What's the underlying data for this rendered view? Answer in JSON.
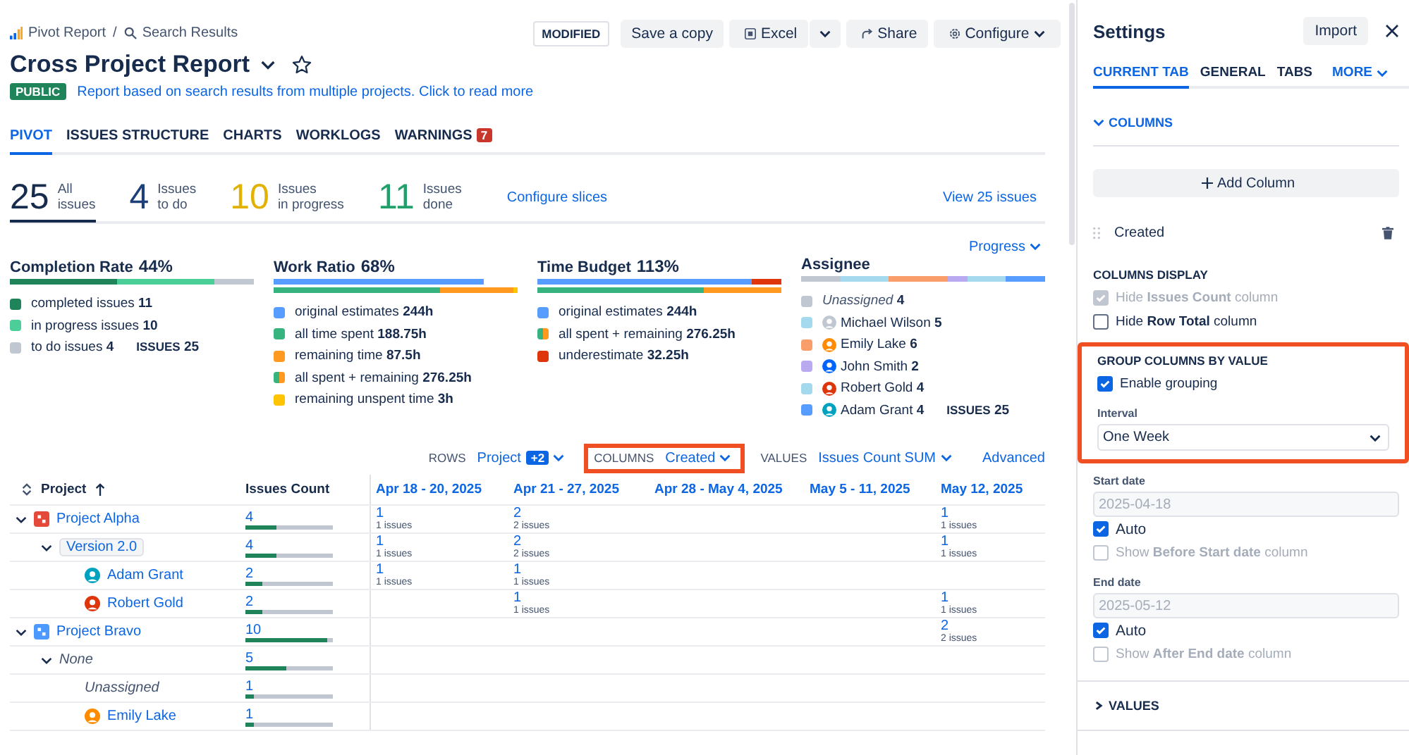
{
  "breadcrumb": {
    "items": [
      {
        "label": "Pivot Report"
      },
      {
        "label": "Search Results"
      }
    ],
    "separator": "/"
  },
  "header": {
    "title": "Cross Project Report",
    "badge": "PUBLIC",
    "description": "Report based on search results from multiple projects. Click to read more",
    "status": "MODIFIED",
    "buttons": [
      {
        "kind": "plain",
        "label": "Save a copy"
      },
      {
        "kind": "excel",
        "label": "Excel"
      },
      {
        "kind": "caret"
      },
      {
        "kind": "share",
        "label": "Share"
      },
      {
        "kind": "configure",
        "label": "Configure"
      }
    ]
  },
  "tabs": [
    {
      "label": "PIVOT",
      "selected": true
    },
    {
      "label": "ISSUES STRUCTURE",
      "selected": false
    },
    {
      "label": "CHARTS",
      "selected": false
    },
    {
      "label": "WORKLOGS",
      "selected": false
    },
    {
      "label": "WARNINGS",
      "selected": false,
      "count": "7"
    }
  ],
  "slices": [
    {
      "value": "25",
      "label": "All\nissues",
      "color": "#172b4d",
      "selected": true
    },
    {
      "value": "4",
      "label": "Issues\nto do",
      "color": "#1d3f7a",
      "selected": false
    },
    {
      "value": "10",
      "label": "Issues\nin progress",
      "color": "#e2b203",
      "selected": false
    },
    {
      "value": "11",
      "label": "Issues\ndone",
      "color": "#22a06b",
      "selected": false
    }
  ],
  "configure_slices": "Configure slices",
  "view_issues": "View 25 issues",
  "group_dropdown": "Progress",
  "metrics": [
    {
      "title": "Completion Rate",
      "value": "44%",
      "bars": [
        {
          "segments": [
            {
              "color": "#1f845a"
            },
            {
              "color": "#4bce97"
            },
            {
              "color": "#c1c7d0"
            }
          ]
        }
      ],
      "legend": [
        {
          "kind": "swatch",
          "label": "completed issues",
          "value": "11",
          "color": "#1f845a"
        },
        {
          "kind": "swatch",
          "label": "in progress issues",
          "value": "10",
          "color": "#4bce97"
        },
        {
          "kind": "swatch",
          "label": "to do issues",
          "value": "4",
          "color": "#c1c7d0"
        }
      ],
      "total_label": "ISSUES",
      "total": "25"
    },
    {
      "title": "Work Ratio",
      "value": "68%",
      "bars": [
        {
          "segments": [
            {
              "color": "#579dff"
            }
          ]
        },
        {
          "segments": [
            {
              "color": "#36b37e"
            },
            {
              "color": "#ff991f"
            },
            {
              "color": "#ffc400"
            }
          ]
        }
      ],
      "legend": [
        {
          "kind": "swatch",
          "label": "original estimates",
          "value": "244h",
          "color": "#579dff"
        },
        {
          "kind": "swatch",
          "label": "all time spent",
          "value": "188.75h",
          "color": "#36b37e"
        },
        {
          "kind": "swatch",
          "label": "remaining time",
          "value": "87.5h",
          "color": "#ff991f"
        },
        {
          "kind": "split",
          "label": "all spent + remaining",
          "value": "276.25h"
        },
        {
          "kind": "swatch",
          "label": "remaining unspent time",
          "value": "3h",
          "color": "#ffc400"
        }
      ]
    },
    {
      "title": "Time Budget",
      "value": "113%",
      "bars": [
        {
          "segments": [
            {
              "color": "#579dff"
            },
            {
              "color": "#de350b"
            }
          ]
        },
        {
          "segments": [
            {
              "color": "#36b37e"
            },
            {
              "color": "#ff991f"
            }
          ]
        }
      ],
      "legend": [
        {
          "kind": "swatch",
          "label": "original estimates",
          "value": "244h",
          "color": "#579dff"
        },
        {
          "kind": "split",
          "label": "all spent + remaining",
          "value": "276.25h"
        },
        {
          "kind": "swatch",
          "label": "underestimate",
          "value": "32.25h",
          "color": "#de350b"
        }
      ]
    },
    {
      "title": "Assignee",
      "bars": [
        {
          "segments": [
            {
              "color": "#c1c7d0"
            },
            {
              "color": "#a4d9ee"
            },
            {
              "color": "#f99d6b"
            },
            {
              "color": "#b8a9f0"
            },
            {
              "color": "#a4d9ee"
            },
            {
              "color": "#579dff"
            }
          ]
        }
      ],
      "legend": [
        {
          "kind": "unassigned",
          "label": "Unassigned",
          "value": "4",
          "color": "#c1c7d0"
        },
        {
          "kind": "person",
          "label": "Michael Wilson",
          "value": "5",
          "color": "#a4d9ee",
          "avatar": {
            "color": "#c1c7d0"
          }
        },
        {
          "kind": "person",
          "label": "Emily Lake",
          "value": "6",
          "color": "#f99d6b",
          "avatar": {
            "color": "#ff8b00"
          }
        },
        {
          "kind": "person",
          "label": "John Smith",
          "value": "2",
          "color": "#b8a9f0",
          "avatar": {
            "color": "#0065ff"
          }
        },
        {
          "kind": "person",
          "label": "Robert Gold",
          "value": "4",
          "color": "#a4d9ee",
          "avatar": {
            "color": "#de350b"
          }
        },
        {
          "kind": "person",
          "label": "Adam Grant",
          "value": "4",
          "color": "#579dff",
          "avatar": {
            "color": "#00a3bf"
          }
        }
      ],
      "total_label": "ISSUES",
      "total": "25"
    }
  ],
  "pivot_controls": [
    {
      "label": "ROWS",
      "value": "Project",
      "badge": "+2",
      "highlighted": false
    },
    {
      "label": "COLUMNS",
      "value": "Created",
      "highlighted": true
    },
    {
      "label": "VALUES",
      "value": "Issues Count SUM",
      "highlighted": false
    }
  ],
  "advanced": "Advanced",
  "table": {
    "columns": [
      "Project",
      "Issues Count"
    ],
    "date_columns": [
      "Apr 18 - 20, 2025",
      "Apr 21 - 27, 2025",
      "Apr 28 - May 4, 2025",
      "May 5 - 11, 2025",
      "May 12, 2025"
    ],
    "rows": [
      {
        "kind": "project",
        "label": "Project Alpha",
        "color": "#e5493a",
        "count": "4",
        "level": 0.35,
        "expanded": true,
        "cells": [
          {
            "value": "1",
            "sub": "1 issues"
          },
          {
            "value": "2",
            "sub": "2 issues"
          },
          null,
          null,
          {
            "value": "1",
            "sub": "1 issues"
          }
        ],
        "children": [
          {
            "kind": "version",
            "label": "Version 2.0",
            "count": "4",
            "level": 0.35,
            "expanded": true,
            "cells": [
              {
                "value": "1",
                "sub": "1 issues"
              },
              {
                "value": "2",
                "sub": "2 issues"
              },
              null,
              null,
              {
                "value": "1",
                "sub": "1 issues"
              }
            ],
            "children": [
              {
                "kind": "person",
                "label": "Adam Grant",
                "color": "#00a3bf",
                "count": "2",
                "level": 0.2,
                "cells": [
                  {
                    "value": "1",
                    "sub": "1 issues"
                  },
                  {
                    "value": "1",
                    "sub": "1 issues"
                  },
                  null,
                  null,
                  null
                ]
              },
              {
                "kind": "person",
                "label": "Robert Gold",
                "color": "#de350b",
                "count": "2",
                "level": 0.2,
                "cells": [
                  null,
                  {
                    "value": "1",
                    "sub": "1 issues"
                  },
                  null,
                  null,
                  {
                    "value": "1",
                    "sub": "1 issues"
                  }
                ]
              }
            ]
          }
        ]
      },
      {
        "kind": "project",
        "label": "Project Bravo",
        "color": "#4c9aff",
        "count": "10",
        "level": 0.93,
        "expanded": true,
        "cells": [
          null,
          null,
          null,
          null,
          {
            "value": "2",
            "sub": "2 issues"
          }
        ],
        "children": [
          {
            "kind": "empty",
            "label": "None",
            "count": "5",
            "level": 0.47,
            "expanded": true,
            "cells": [
              null,
              null,
              null,
              null,
              null
            ],
            "children": [
              {
                "kind": "empty",
                "label": "Unassigned",
                "count": "1",
                "level": 0.1,
                "cells": [
                  null,
                  null,
                  null,
                  null,
                  null
                ]
              },
              {
                "kind": "person",
                "label": "Emily Lake",
                "color": "#ff8b00",
                "count": "1",
                "level": 0.1,
                "cells": [
                  null,
                  null,
                  null,
                  null,
                  null
                ]
              }
            ]
          }
        ]
      }
    ]
  },
  "settings": {
    "title": "Settings",
    "import": "Import",
    "tabs": [
      {
        "label": "CURRENT TAB",
        "selected": true
      },
      {
        "label": "GENERAL",
        "selected": false
      },
      {
        "label": "TABS",
        "selected": false
      },
      {
        "label": "MORE",
        "selected": false,
        "dropdown": true
      }
    ],
    "columns_section": {
      "label": "COLUMNS",
      "expanded": true,
      "add_button": "Add Column",
      "items": [
        "Created"
      ],
      "display_heading": "COLUMNS DISPLAY",
      "display_options": [
        {
          "label": "Hide **Issues Count** column",
          "checked": true,
          "disabled": true
        },
        {
          "label": "Hide **Row Total** column",
          "checked": false,
          "disabled": false
        }
      ]
    },
    "grouping": {
      "heading": "GROUP COLUMNS BY VALUE",
      "highlighted": true,
      "enable": {
        "label": "Enable grouping",
        "checked": true
      },
      "interval_label": "Interval",
      "interval_value": "One Week"
    },
    "dates": [
      {
        "label": "Start date",
        "value": "2025-04-18",
        "disabled": true,
        "auto": {
          "label": "Auto",
          "checked": true
        },
        "show": {
          "label": "Show **Before Start date** column",
          "checked": false,
          "disabled": true
        }
      },
      {
        "label": "End date",
        "value": "2025-05-12",
        "disabled": true,
        "auto": {
          "label": "Auto",
          "checked": true
        },
        "show": {
          "label": "Show **After End date** column",
          "checked": false,
          "disabled": true
        }
      }
    ],
    "values_section": {
      "label": "VALUES",
      "expanded": false
    }
  }
}
